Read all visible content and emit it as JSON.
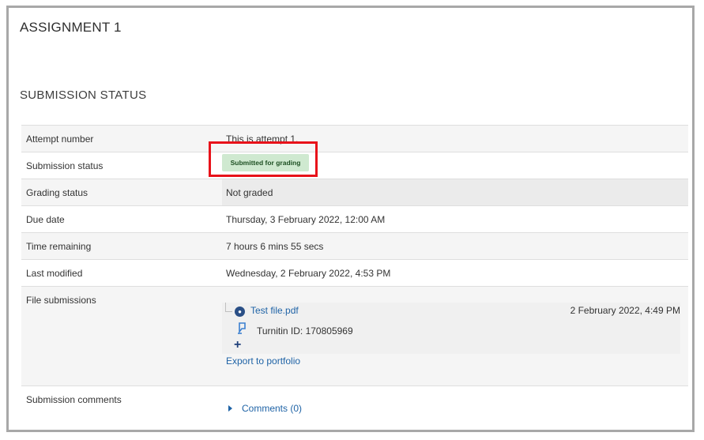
{
  "assignment_title": "ASSIGNMENT 1",
  "section_title": "SUBMISSION STATUS",
  "rows": {
    "attempt": {
      "label": "Attempt number",
      "value": "This is attempt 1."
    },
    "status": {
      "label": "Submission status",
      "value": "Submitted for grading"
    },
    "grading": {
      "label": "Grading status",
      "value": "Not graded"
    },
    "due": {
      "label": "Due date",
      "value": "Thursday, 3 February 2022, 12:00 AM"
    },
    "time": {
      "label": "Time remaining",
      "value": "7 hours 6 mins 55 secs"
    },
    "modified": {
      "label": "Last modified",
      "value": "Wednesday, 2 February 2022, 4:53 PM"
    },
    "files": {
      "label": "File submissions",
      "file_name": "Test file.pdf",
      "file_date": "2 February 2022, 4:49 PM",
      "turnitin": "Turnitin ID: 170805969",
      "export_link": "Export to portfolio"
    },
    "comments": {
      "label": "Submission comments",
      "link": "Comments (0)"
    }
  },
  "colors": {
    "badge_bg": "#cfe9d0",
    "link": "#1f63a6",
    "highlight": "#e8121a"
  }
}
